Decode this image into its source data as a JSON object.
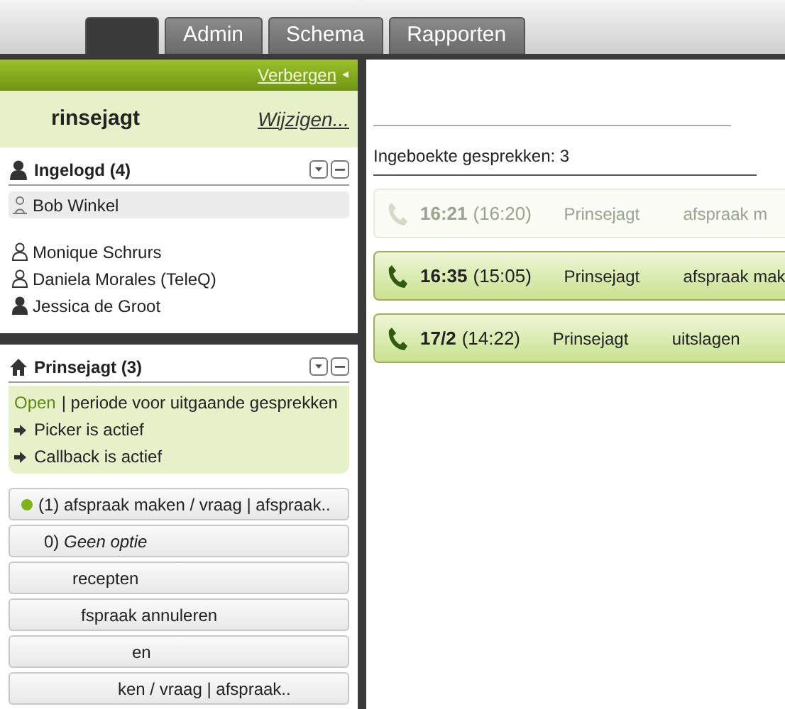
{
  "tabs": [
    {
      "selected": true
    },
    {
      "label": "Admin",
      "selected": false
    },
    {
      "label": "Schema",
      "selected": false
    },
    {
      "label": "Rapporten",
      "selected": false
    }
  ],
  "sidebar": {
    "hide_link": "Verbergen",
    "hide_arrow": "◂",
    "header": {
      "title": "rinsejagt",
      "action": "Wijzigen..."
    },
    "logged_in": {
      "title": "Ingelogd (4)",
      "users": [
        {
          "name": "Bob Winkel",
          "selected": true,
          "kind": "away"
        },
        {
          "name": "Monique Schrurs",
          "selected": false,
          "kind": "available"
        },
        {
          "name": "Daniela Morales (TeleQ)",
          "selected": false,
          "kind": "available"
        },
        {
          "name": "Jessica de Groot",
          "selected": false,
          "kind": "busy"
        }
      ]
    },
    "queue": {
      "title": "Prinsejagt (3)",
      "status": "Open",
      "status_text": "| periode voor uitgaande gesprekken",
      "features": [
        "Picker is actief",
        "Callback is actief"
      ],
      "options": [
        {
          "label": "(1)  afspraak maken / vraag | afspraak..",
          "active": true
        },
        {
          "label": "0) *Geen optie*",
          "active": false
        },
        {
          "label": "recepten",
          "active": false
        },
        {
          "label": "fspraak annuleren",
          "active": false
        },
        {
          "label": "en",
          "active": false
        },
        {
          "label": "ken / vraag | afspraak..",
          "active": false
        }
      ]
    }
  },
  "main": {
    "booked_label": "Ingeboekte gesprekken: 3",
    "calls": [
      {
        "time": "16:21",
        "original_time": "(16:20)",
        "queue": "Prinsejagt",
        "subject": "afspraak m",
        "disabled": true
      },
      {
        "time": "16:35",
        "original_time": "(15:05)",
        "queue": "Prinsejagt",
        "subject": "afspraak mak",
        "disabled": false
      },
      {
        "time": "17/2",
        "original_time": "(14:22)",
        "queue": "Prinsejagt",
        "subject": "uitslagen",
        "disabled": false
      }
    ]
  }
}
